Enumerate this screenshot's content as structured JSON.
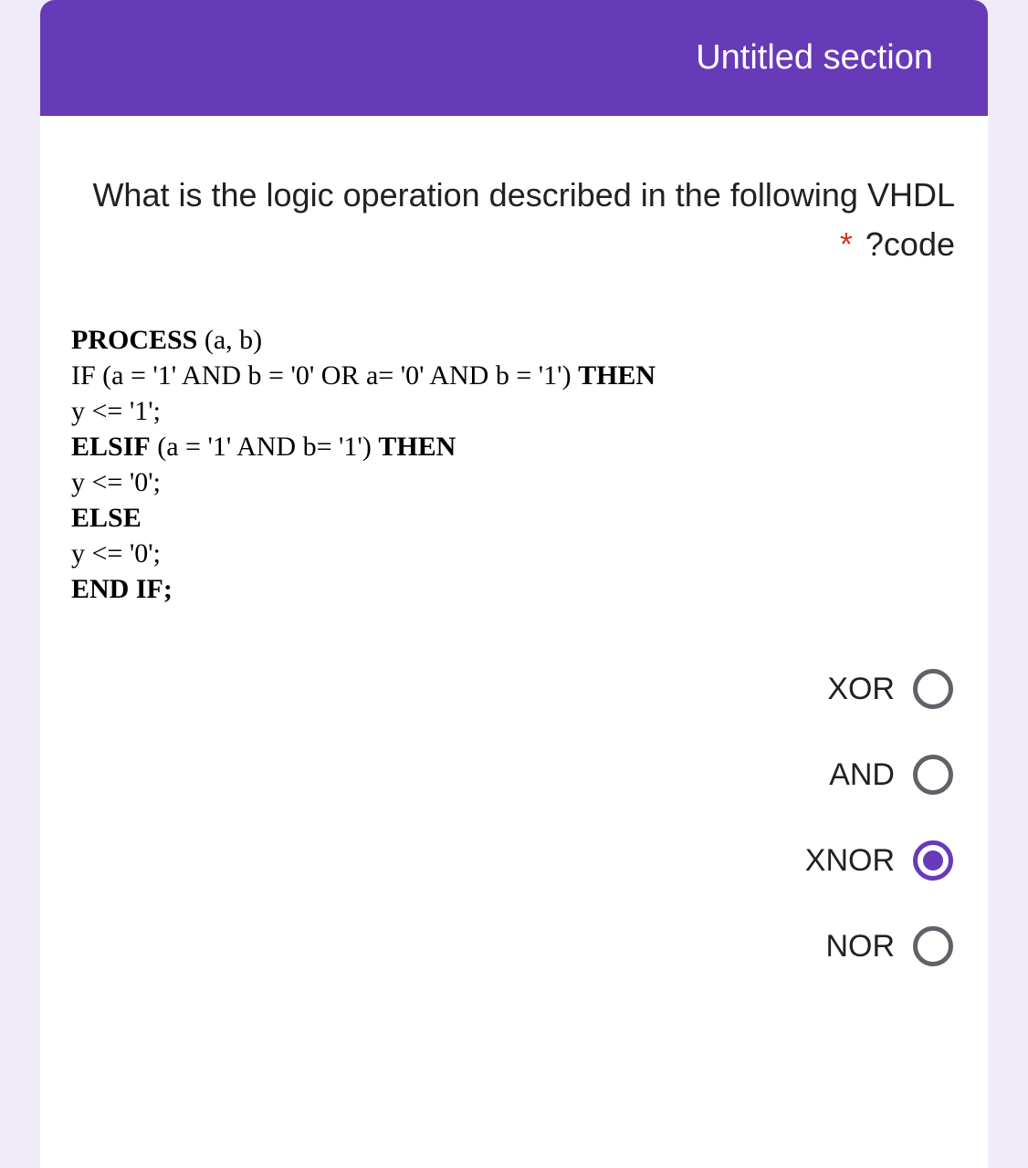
{
  "section": {
    "title": "Untitled section"
  },
  "question": {
    "line1": "What is the logic operation described in the",
    "line2": "following VHDL code?",
    "required_marker": "*"
  },
  "code": {
    "l1a": "PROCESS",
    "l1b": " (a, b)",
    "l2a": "IF (a = '1' AND b = '0' OR a= '0' AND b = '1') ",
    "l2b": "THEN",
    "l3": "y <= '1';",
    "l4a": "ELSIF",
    "l4b": " (a = '1' AND b= '1') ",
    "l4c": "THEN",
    "l5": "y <= '0';",
    "l6": "ELSE",
    "l7": " y <= '0';",
    "l8": "END IF;"
  },
  "options": [
    {
      "label": "XOR",
      "selected": false
    },
    {
      "label": "AND",
      "selected": false
    },
    {
      "label": "XNOR",
      "selected": true
    },
    {
      "label": "NOR",
      "selected": false
    }
  ]
}
